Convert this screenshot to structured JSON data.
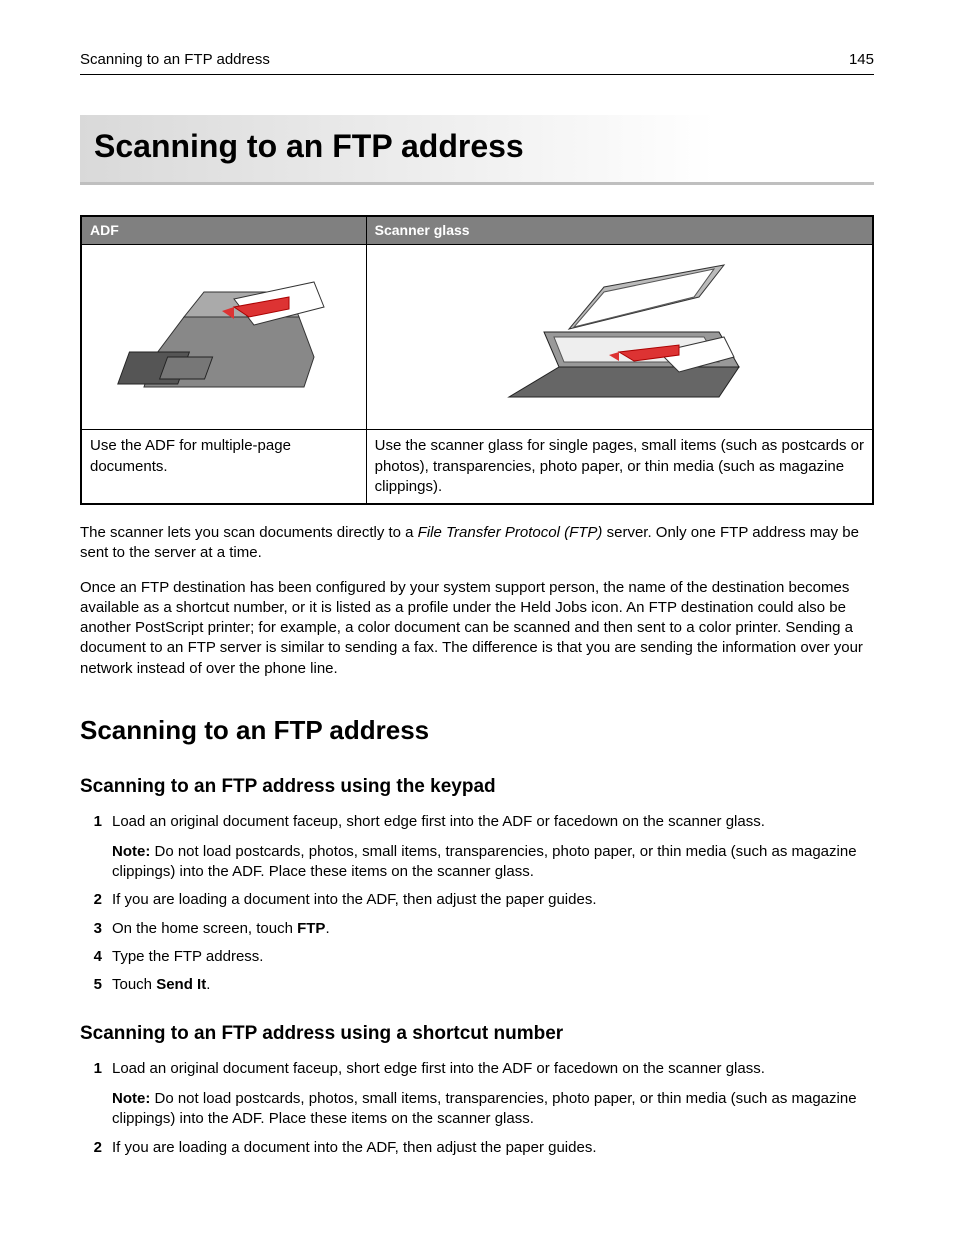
{
  "header": {
    "left": "Scanning to an FTP address",
    "right": "145"
  },
  "chapter_title": "Scanning to an FTP address",
  "table": {
    "headers": [
      "ADF",
      "Scanner glass"
    ],
    "captions": [
      "Use the ADF for multiple‑page documents.",
      "Use the scanner glass for single pages, small items (such as postcards or photos), transparencies, photo paper, or thin media (such as magazine clippings)."
    ]
  },
  "intro": {
    "p1_a": "The scanner lets you scan documents directly to a ",
    "p1_i": "File Transfer Protocol (FTP)",
    "p1_b": " server. Only one FTP address may be sent to the server at a time.",
    "p2": "Once an FTP destination has been configured by your system support person, the name of the destination becomes available as a shortcut number, or it is listed as a profile under the Held Jobs icon. An FTP destination could also be another PostScript printer; for example, a color document can be scanned and then sent to a color printer. Sending a document to an FTP server is similar to sending a fax. The difference is that you are sending the information over your network instead of over the phone line."
  },
  "section_title": "Scanning to an FTP address",
  "sub1": {
    "title": "Scanning to an FTP address using the keypad",
    "steps": [
      {
        "num": "1",
        "text": "Load an original document faceup, short edge first into the ADF or facedown on the scanner glass.",
        "note_label": "Note:",
        "note": " Do not load postcards, photos, small items, transparencies, photo paper, or thin media (such as magazine clippings) into the ADF. Place these items on the scanner glass."
      },
      {
        "num": "2",
        "text": "If you are loading a document into the ADF, then adjust the paper guides."
      },
      {
        "num": "3",
        "text_a": "On the home screen, touch ",
        "bold": "FTP",
        "text_b": "."
      },
      {
        "num": "4",
        "text": "Type the FTP address."
      },
      {
        "num": "5",
        "text_a": "Touch ",
        "bold": "Send It",
        "text_b": "."
      }
    ]
  },
  "sub2": {
    "title": "Scanning to an FTP address using a shortcut number",
    "steps": [
      {
        "num": "1",
        "text": "Load an original document faceup, short edge first into the ADF or facedown on the scanner glass.",
        "note_label": "Note:",
        "note": " Do not load postcards, photos, small items, transparencies, photo paper, or thin media (such as magazine clippings) into the ADF. Place these items on the scanner glass."
      },
      {
        "num": "2",
        "text": "If you are loading a document into the ADF, then adjust the paper guides."
      }
    ]
  }
}
